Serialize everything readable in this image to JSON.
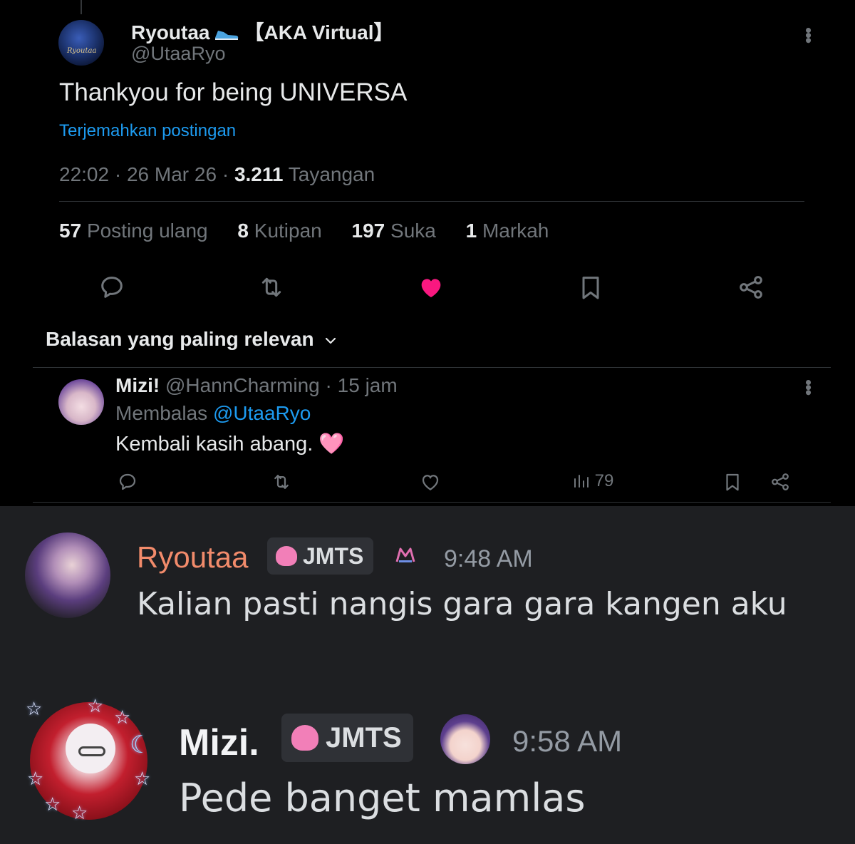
{
  "tweet": {
    "author_name": "Ryoutaa",
    "author_tag": "【AKA Virtual】",
    "author_handle": "@UtaaRyo",
    "avatar_signature": "Ryoutaa",
    "text": "Thankyou for being UNIVERSA",
    "translate_link": "Terjemahkan postingan",
    "time": "22:02",
    "date": "26 Mar 26",
    "views_count": "3.211",
    "views_label": "Tayangan",
    "stats": [
      {
        "count": "57",
        "label": "Posting ulang"
      },
      {
        "count": "8",
        "label": "Kutipan"
      },
      {
        "count": "197",
        "label": "Suka"
      },
      {
        "count": "1",
        "label": "Markah"
      }
    ],
    "actions": [
      "reply-icon",
      "retweet-icon",
      "heart-filled-icon",
      "bookmark-icon",
      "share-icon"
    ],
    "like_color": "#f91880"
  },
  "replies_sort": {
    "label": "Balasan yang paling relevan",
    "icon": "chevron-down-icon"
  },
  "reply": {
    "name": "Mizi!",
    "handle": "@HannCharming",
    "time": "15 jam",
    "replying_prefix": "Membalas",
    "replying_to": "@UtaaRyo",
    "text": "Kembali kasih abang. 🩷",
    "views": "79"
  },
  "discord": {
    "messages": [
      {
        "author": "Ryoutaa",
        "author_color": "#f28b6b",
        "tag": "JMTS",
        "time": "9:48 AM",
        "text": "Kalian pasti nangis gara gara kangen aku"
      },
      {
        "author": "Mizi.",
        "author_color": "#f2f3f5",
        "tag": "JMTS",
        "time": "9:58 AM",
        "text": "Pede banget mamlas"
      }
    ],
    "tag_icon": "skull-icon",
    "tag_icon_color": "#f27fb8"
  }
}
